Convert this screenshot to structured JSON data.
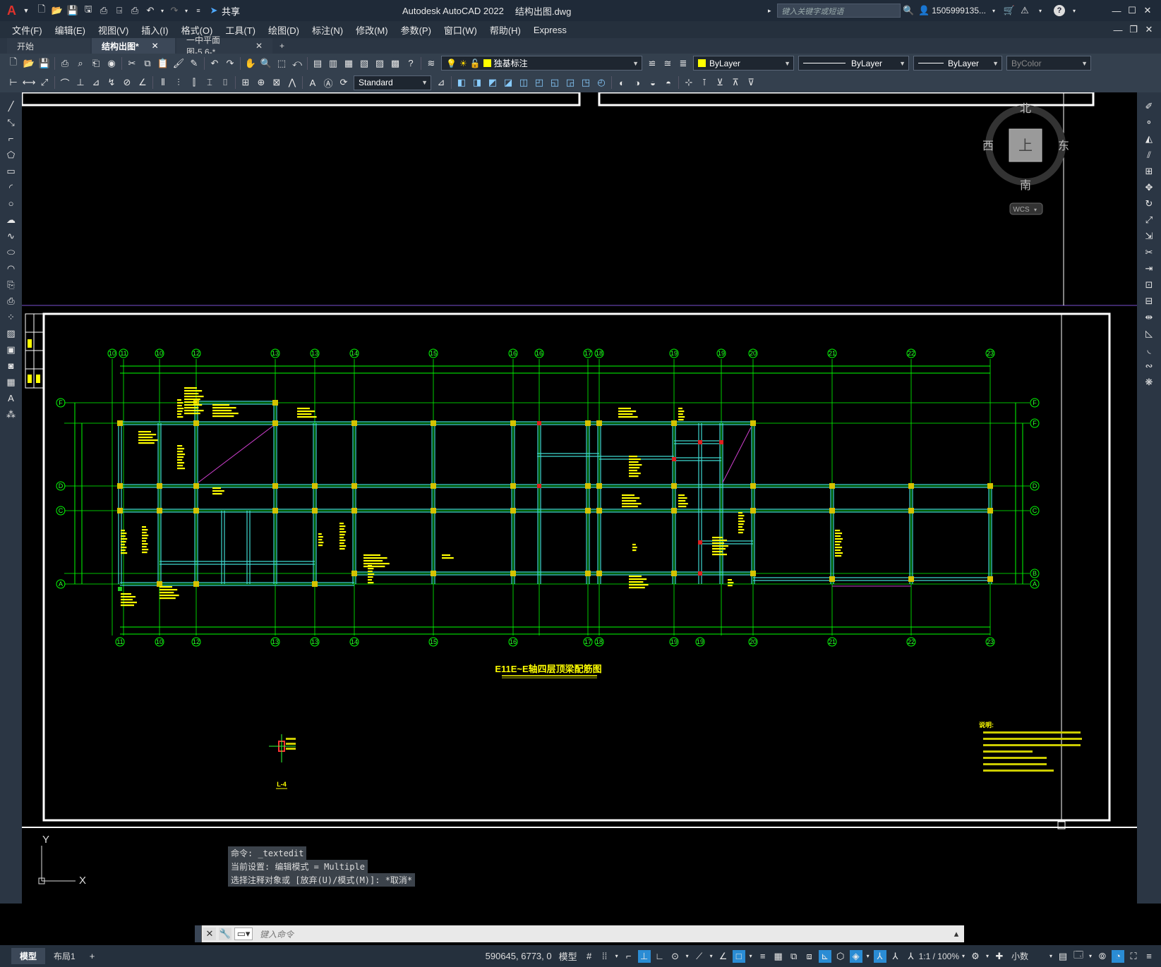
{
  "app": {
    "logo": "A",
    "title": "Autodesk AutoCAD 2022",
    "filename": "结构出图.dwg",
    "share_label": "共享",
    "search_placeholder": "键入关键字或短语",
    "user": "1505999135...",
    "help_icon": "?"
  },
  "menu": [
    "文件(F)",
    "编辑(E)",
    "视图(V)",
    "插入(I)",
    "格式(O)",
    "工具(T)",
    "绘图(D)",
    "标注(N)",
    "修改(M)",
    "参数(P)",
    "窗口(W)",
    "帮助(H)",
    "Express"
  ],
  "tabs": [
    {
      "label": "开始",
      "active": false
    },
    {
      "label": "结构出图*",
      "active": true
    },
    {
      "label": "一中平面图-5.6-*",
      "active": false
    }
  ],
  "toolbar": {
    "layer_name": "独基标注",
    "color": "ByLayer",
    "linetype": "ByLayer",
    "lineweight": "ByLayer",
    "plotstyle": "ByColor",
    "textstyle": "Standard"
  },
  "viewcube": {
    "north": "北",
    "south": "南",
    "east": "东",
    "west": "西",
    "face": "上",
    "wcs": "WCS"
  },
  "drawing": {
    "title": "E11E~E轴四层顶梁配筋图",
    "detail_label": "L-4",
    "notes_title": "说明:",
    "top_axes": [
      "10",
      "11",
      "10",
      "12",
      "13",
      "13",
      "14",
      "15",
      "16",
      "16",
      "17",
      "18",
      "19",
      "19",
      "20",
      "21",
      "22",
      "23"
    ],
    "bottom_axes": [
      "11",
      "10",
      "12",
      "13",
      "13",
      "14",
      "15",
      "16",
      "17",
      "18",
      "19",
      "19",
      "20",
      "21",
      "22",
      "23"
    ],
    "left_axes": [
      "F",
      "D",
      "C",
      "A"
    ],
    "right_axes": [
      "F",
      "F",
      "D",
      "C",
      "B",
      "A"
    ]
  },
  "command": {
    "history": [
      "命令: _textedit",
      "当前设置: 编辑模式 = Multiple",
      "选择注释对象或 [放弃(U)/模式(M)]: *取消*"
    ],
    "placeholder": "键入命令"
  },
  "layout_tabs": [
    "模型",
    "布局1"
  ],
  "status": {
    "coords": "590645, 6773, 0",
    "space": "模型",
    "scale": "1:1 / 100%",
    "units": "小数"
  },
  "ucs": {
    "x": "X",
    "y": "Y"
  },
  "colors": {
    "accent": "#2a8cd4",
    "grid_green": "#00ff00",
    "beam_cyan": "#3fd9d0",
    "column_yellow": "#d6c200",
    "annotation_yellow": "#ffff00",
    "frame": "#ffffff",
    "logo_red": "#e0322c"
  }
}
